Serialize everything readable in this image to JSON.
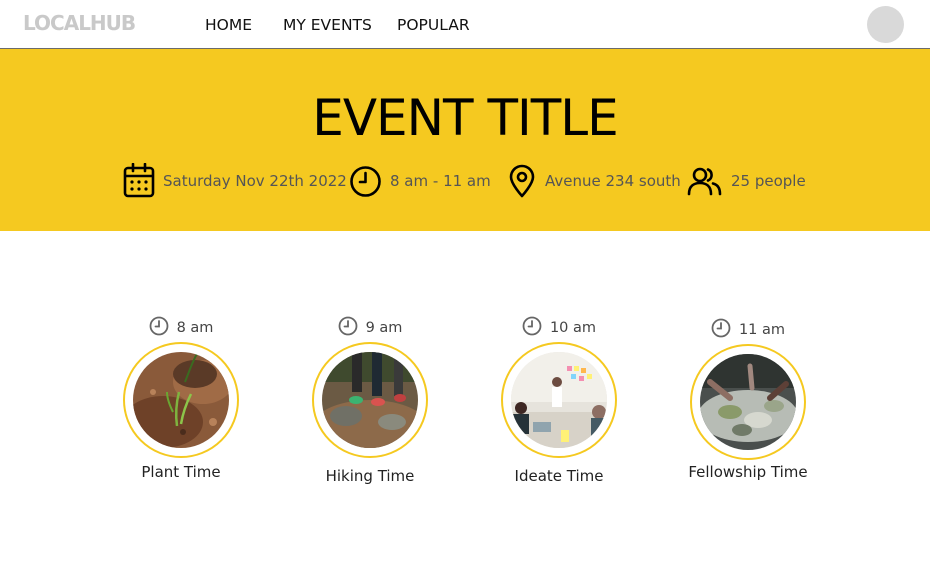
{
  "nav": {
    "logo": "LOCALHUB",
    "links": [
      "HOME",
      "MY EVENTS",
      "POPULAR"
    ]
  },
  "hero": {
    "title": "EVENT TITLE",
    "date": "Saturday Nov 22th 2022",
    "time": "8 am - 11 am",
    "location": "Avenue 234 south",
    "attendees": "25 people"
  },
  "agenda": [
    {
      "time": "8 am",
      "label": "Plant Time"
    },
    {
      "time": "9 am",
      "label": "Hiking Time"
    },
    {
      "time": "10 am",
      "label": "Ideate Time"
    },
    {
      "time": "11 am",
      "label": "Fellowship Time"
    }
  ],
  "colors": {
    "accent": "#f5c920",
    "logo": "#c9c9c9",
    "avatar": "#d9d9d9"
  },
  "icons": {
    "date": "calendar-icon",
    "time": "clock-icon",
    "location": "map-pin-icon",
    "attendees": "people-icon"
  }
}
